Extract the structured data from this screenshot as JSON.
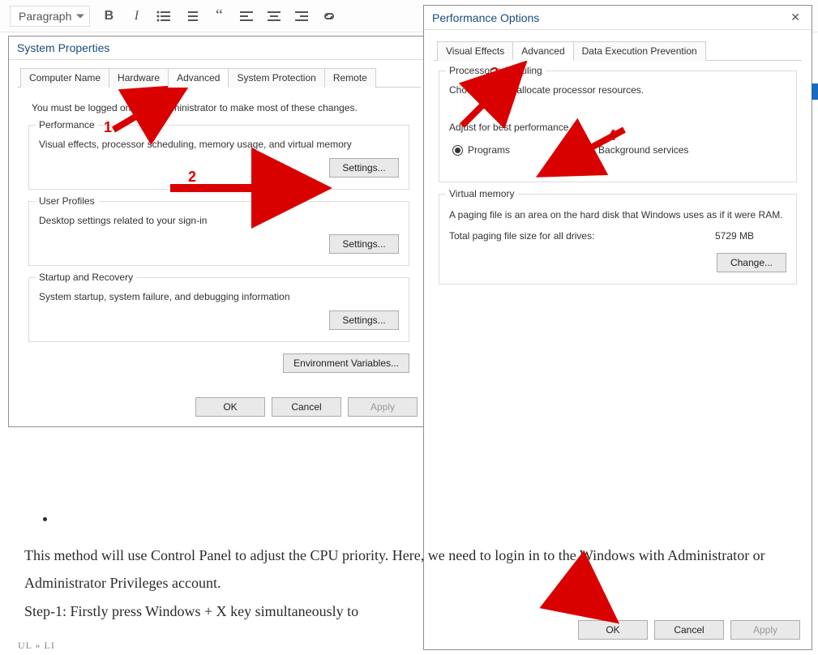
{
  "editor": {
    "paragraph": "Paragraph"
  },
  "sysprops": {
    "title": "System Properties",
    "tabs": {
      "computer_name": "Computer Name",
      "hardware": "Hardware",
      "advanced": "Advanced",
      "system_protection": "System Protection",
      "remote": "Remote"
    },
    "intro": "You must be logged on as an Administrator to make most of these changes.",
    "performance": {
      "title": "Performance",
      "desc": "Visual effects, processor scheduling, memory usage, and virtual memory",
      "settings_btn": "Settings..."
    },
    "user_profiles": {
      "title": "User Profiles",
      "desc": "Desktop settings related to your sign-in",
      "settings_btn": "Settings..."
    },
    "startup": {
      "title": "Startup and Recovery",
      "desc": "System startup, system failure, and debugging information",
      "settings_btn": "Settings..."
    },
    "env_btn": "Environment Variables...",
    "footer": {
      "ok": "OK",
      "cancel": "Cancel",
      "apply": "Apply"
    }
  },
  "perfopts": {
    "title": "Performance Options",
    "tabs": {
      "visual": "Visual Effects",
      "advanced": "Advanced",
      "dep": "Data Execution Prevention"
    },
    "proc_sched": {
      "title": "Processor scheduling",
      "desc": "Choose how to allocate processor resources.",
      "adjust": "Adjust for best performance of:",
      "programs": "Programs",
      "background": "Background services"
    },
    "vm": {
      "title": "Virtual memory",
      "desc": "A paging file is an area on the hard disk that Windows uses as if it were RAM.",
      "total_label": "Total paging file size for all drives:",
      "total_value": "5729 MB",
      "change_btn": "Change..."
    },
    "footer": {
      "ok": "OK",
      "cancel": "Cancel",
      "apply": "Apply"
    }
  },
  "anno": {
    "n1": "1",
    "n2": "2",
    "n3": "3",
    "n4": "4"
  },
  "article": {
    "p1": "This method will use Control Panel to adjust the CPU priority. Here, we need to login in to the Windows with Administrator or Administrator Privileges account.",
    "p2_prefix": "Step-1: Firstly press Windows + X key simultaneously to"
  },
  "path_footer": "UL » LI"
}
